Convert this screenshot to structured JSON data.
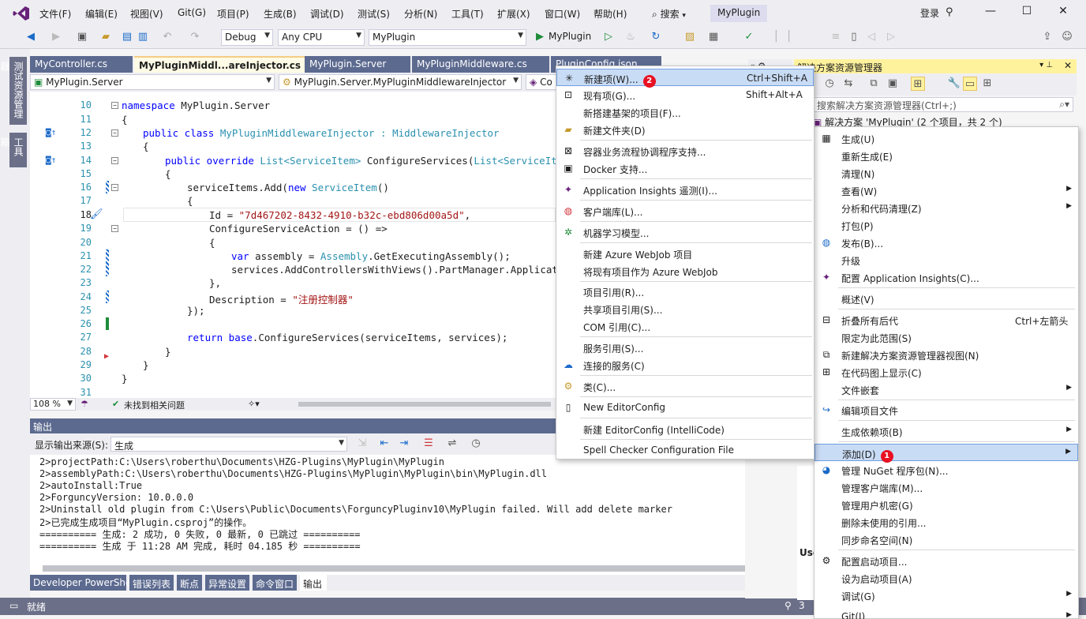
{
  "menu_bar": {
    "items": [
      "文件(F)",
      "编辑(E)",
      "视图(V)",
      "Git(G)",
      "项目(P)",
      "生成(B)",
      "调试(D)",
      "测试(S)",
      "分析(N)",
      "工具(T)",
      "扩展(X)",
      "窗口(W)",
      "帮助(H)"
    ],
    "search_label": "搜索",
    "project_name": "MyPlugin",
    "login_label": "登录",
    "minimize": "—",
    "restore": "☐",
    "close": "✕"
  },
  "toolbar": {
    "config": "Debug",
    "platform": "Any CPU",
    "startup_project": "MyPlugin",
    "run_label": "MyPlugin"
  },
  "left_strip": {
    "tab1": "测试资源管理器",
    "tab2": "工具箱"
  },
  "doc_tabs": [
    {
      "label": "MyController.cs"
    },
    {
      "label": "MyPluginMiddl...areInjector.cs"
    },
    {
      "label": "MyPlugin.Server"
    },
    {
      "label": "MyPluginMiddleware.cs"
    },
    {
      "label": "PluginConfig.json"
    }
  ],
  "nav_bar": {
    "project": "MyPlugin.Server",
    "type": "MyPlugin.Server.MyPluginMiddlewareInjector",
    "member": "Co"
  },
  "code": {
    "line_numbers": [
      "10",
      "11",
      "12",
      "13",
      "14",
      "15",
      "16",
      "17",
      "18",
      "19",
      "20",
      "21",
      "22",
      "23",
      "24",
      "25",
      "26",
      "27",
      "28",
      "29",
      "30",
      "31"
    ],
    "l10_kw": "namespace",
    "l10_rest": " MyPlugin.Server",
    "l11": "{",
    "l12_kw": "public class",
    "l12_name": " MyPluginMiddlewareInjector : ",
    "l12_base": "MiddlewareInjector",
    "l13": "{",
    "l14_kw": "public override",
    "l14_t1": " List",
    "l14_t2": "<ServiceItem>",
    "l14_rest": " ConfigureServices(",
    "l14_t3": "List",
    "l14_t4": "<ServiceItem>",
    "l15": "{",
    "l16_a": "serviceItems.Add(",
    "l16_kw": "new",
    "l16_ty": " ServiceItem",
    "l16_b": "()",
    "l17": "{",
    "l18_a": "Id = ",
    "l18_str": "\"7d467202-8432-4910-b32c-ebd806d00a5d\"",
    "l18_b": ",",
    "l19": "ConfigureServiceAction = () =>",
    "l20": "{",
    "l21_kw": "var",
    "l21_a": " assembly = ",
    "l21_ty": "Assembly",
    "l21_b": ".GetExecutingAssembly();",
    "l22": "services.AddControllersWithViews().PartManager.ApplicationP",
    "l23": "},",
    "l24_a": "Description = ",
    "l24_str": "\"注册控制器\"",
    "l25": "});",
    "l27_kw": "return",
    "l27_kw2": " base",
    "l27_rest": ".ConfigureServices(serviceItems, services);",
    "l28": "}",
    "l29": "}",
    "l30": "}"
  },
  "editor_status": {
    "zoom": "108 %",
    "issues": "未找到相关问题"
  },
  "output": {
    "title": "输出",
    "source_label": "显示输出来源(S):",
    "source_value": "生成",
    "lines": [
      "2>projectPath:C:\\Users\\roberthu\\Documents\\HZG-Plugins\\MyPlugin\\MyPlugin",
      "2>assemblyPath:C:\\Users\\roberthu\\Documents\\HZG-Plugins\\MyPlugin\\MyPlugin\\bin\\MyPlugin.dll",
      "2>autoInstall:True",
      "2>ForguncyVersion: 10.0.0.0",
      "2>Uninstall old plugin from C:\\Users\\Public\\Documents\\ForguncyPluginv10\\MyPlugin failed. Will add delete marker",
      "2>已完成生成项目“MyPlugin.csproj”的操作。",
      "========== 生成: 2 成功, 0 失败, 0 最新, 0 已跳过 ==========",
      "========== 生成 于 11:28 AM 完成, 耗时 04.185 秒 =========="
    ]
  },
  "bottom_tabs": [
    "Developer PowerShell",
    "错误列表",
    "断点",
    "异常设置",
    "命令窗口",
    "输出"
  ],
  "status_bar": {
    "ready": "就绪",
    "right": "3"
  },
  "solution_explorer": {
    "title": "解决方案资源管理器",
    "search_placeholder": "搜索解决方案资源管理器(Ctrl+;)",
    "root": "解决方案 'MyPlugin' (2 个项目，共 2 个)",
    "peek_1": "Use"
  },
  "project_menu": {
    "items": [
      {
        "label": "生成(U)"
      },
      {
        "label": "重新生成(E)"
      },
      {
        "label": "清理(N)"
      },
      {
        "label": "查看(W)",
        "sub": true
      },
      {
        "label": "分析和代码清理(Z)",
        "sub": true
      },
      {
        "label": "打包(P)"
      },
      {
        "label": "发布(B)..."
      },
      {
        "label": "升级"
      },
      {
        "label": "配置 Application Insights(C)..."
      },
      {
        "label": "概述(V)"
      },
      {
        "label": "折叠所有后代",
        "shortcut": "Ctrl+左箭头"
      },
      {
        "label": "限定为此范围(S)"
      },
      {
        "label": "新建解决方案资源管理器视图(N)"
      },
      {
        "label": "在代码图上显示(C)"
      },
      {
        "label": "文件嵌套",
        "sub": true
      },
      {
        "label": "编辑项目文件"
      },
      {
        "label": "生成依赖项(B)",
        "sub": true
      },
      {
        "label": "添加(D)",
        "sub": true,
        "badge": "1"
      },
      {
        "label": "管理 NuGet 程序包(N)..."
      },
      {
        "label": "管理客户端库(M)..."
      },
      {
        "label": "管理用户机密(G)"
      },
      {
        "label": "删除未使用的引用..."
      },
      {
        "label": "同步命名空间(N)"
      },
      {
        "label": "配置启动项目..."
      },
      {
        "label": "设为启动项目(A)"
      },
      {
        "label": "调试(G)",
        "sub": true
      },
      {
        "label": "Git(I)",
        "sub": true
      }
    ]
  },
  "add_menu": {
    "items": [
      {
        "label": "新建项(W)...",
        "shortcut": "Ctrl+Shift+A",
        "badge": "2"
      },
      {
        "label": "现有项(G)...",
        "shortcut": "Shift+Alt+A"
      },
      {
        "label": "新搭建基架的项目(F)..."
      },
      {
        "label": "新建文件夹(D)"
      },
      {
        "label": "容器业务流程协调程序支持..."
      },
      {
        "label": "Docker 支持..."
      },
      {
        "label": "Application Insights 遥测(I)..."
      },
      {
        "label": "客户端库(L)..."
      },
      {
        "label": "机器学习模型..."
      },
      {
        "label": "新建 Azure WebJob 项目"
      },
      {
        "label": "将现有项目作为 Azure WebJob"
      },
      {
        "label": "项目引用(R)..."
      },
      {
        "label": "共享项目引用(S)..."
      },
      {
        "label": "COM 引用(C)..."
      },
      {
        "label": "服务引用(S)..."
      },
      {
        "label": "连接的服务(C)"
      },
      {
        "label": "类(C)..."
      },
      {
        "label": "New EditorConfig"
      },
      {
        "label": "新建 EditorConfig (IntelliCode)"
      },
      {
        "label": "Spell Checker Configuration File"
      }
    ]
  },
  "colors": {
    "accent": "#68217a",
    "badge": "#e81123",
    "highlight": "#c9dcf5",
    "status_bar": "#6b6f88"
  }
}
